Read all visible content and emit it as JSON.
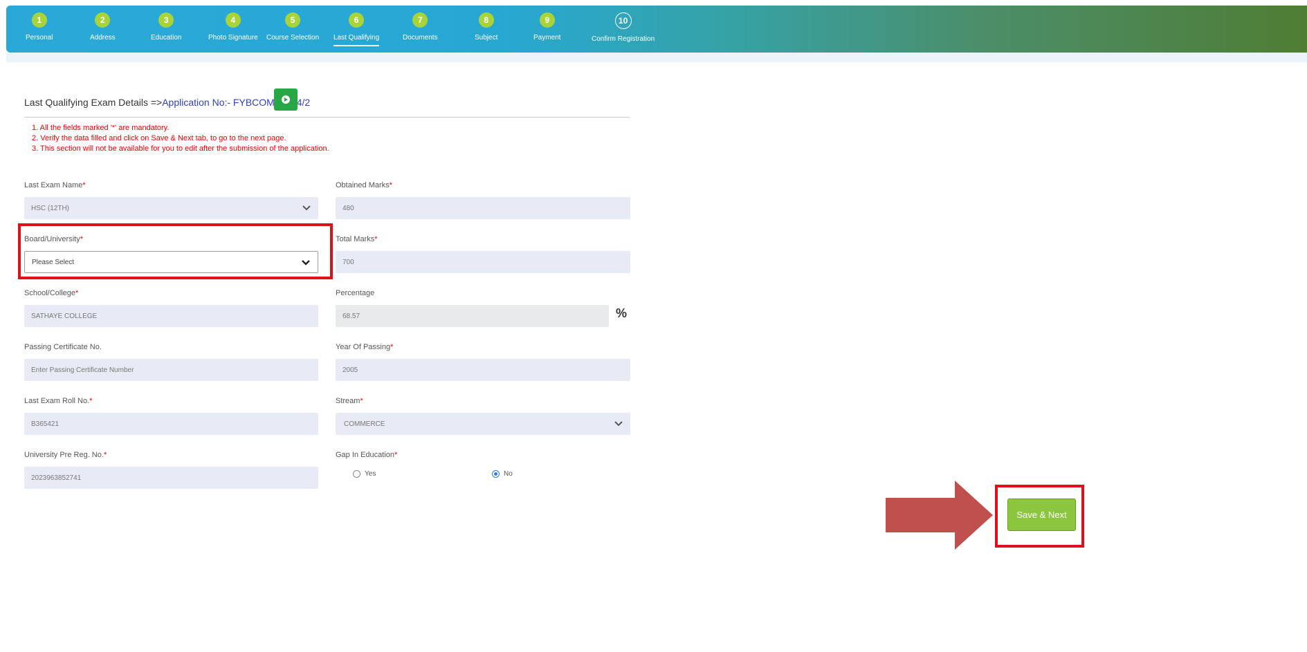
{
  "steps": [
    {
      "num": "1",
      "label": "Personal"
    },
    {
      "num": "2",
      "label": "Address"
    },
    {
      "num": "3",
      "label": "Education"
    },
    {
      "num": "4",
      "label": "Photo Signature"
    },
    {
      "num": "5",
      "label": "Course Selection"
    },
    {
      "num": "6",
      "label": "Last Qualifying"
    },
    {
      "num": "7",
      "label": "Documents"
    },
    {
      "num": "8",
      "label": "Subject"
    },
    {
      "num": "9",
      "label": "Payment"
    },
    {
      "num": "10",
      "label": "Confirm Registration"
    }
  ],
  "active_step": "6",
  "header": {
    "title": "Last Qualifying Exam Details =>",
    "app_no": "Application No:- FYBCOM/23-24/2"
  },
  "notes": [
    "1. All the fields marked '*' are mandatory.",
    "2. Verify the data filled and click on Save & Next tab, to go to the next page.",
    "3. This section will not be available for you to edit after the submission of the application."
  ],
  "form": {
    "last_exam_name": {
      "label": "Last Exam Name",
      "value": "HSC (12TH)"
    },
    "obtained_marks": {
      "label": "Obtained Marks",
      "value": "480"
    },
    "board_university": {
      "label": "Board/University",
      "value": "Please Select"
    },
    "total_marks": {
      "label": "Total Marks",
      "value": "700"
    },
    "school_college": {
      "label": "School/College",
      "value": "SATHAYE COLLEGE"
    },
    "percentage": {
      "label": "Percentage",
      "value": "68.57",
      "suffix": "%"
    },
    "passing_cert": {
      "label": "Passing Certificate No.",
      "placeholder": "Enter Passing Certificate Number"
    },
    "year_of_passing": {
      "label": "Year Of Passing",
      "value": "2005"
    },
    "roll_no": {
      "label": "Last Exam Roll No.",
      "value": "B365421"
    },
    "stream": {
      "label": "Stream",
      "value": "COMMERCE"
    },
    "pre_reg_no": {
      "label": "University Pre Reg. No.",
      "value": "2023963852741"
    },
    "gap_in_education": {
      "label": "Gap In Education",
      "options": [
        "Yes",
        "No"
      ],
      "selected": "No"
    }
  },
  "required_mark": "*",
  "save_button": "Save & Next",
  "colors": {
    "accent_green": "#8cc63f",
    "highlight_red": "#e0101a",
    "arrow": "#c0504d"
  }
}
